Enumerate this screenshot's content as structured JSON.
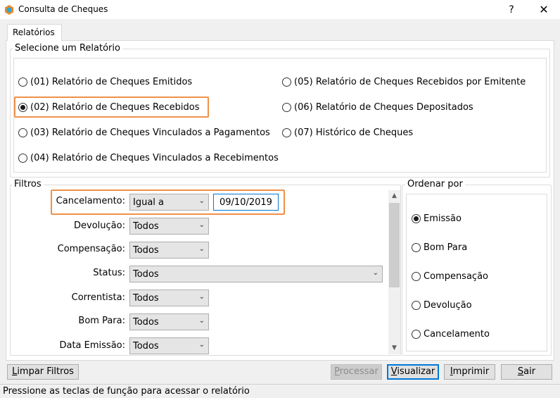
{
  "window": {
    "title": "Consulta de Cheques",
    "help": "?",
    "close": "✕",
    "accent_color": "#0078d7",
    "highlight_color": "#f0914a"
  },
  "tabs": [
    {
      "label": "Relatórios",
      "active": true
    }
  ],
  "report_group": {
    "legend": "Selecione um Relatório",
    "options": [
      {
        "label": "(01) Relatório de Cheques Emitidos",
        "selected": false
      },
      {
        "label": "(02) Relatório de Cheques Recebidos",
        "selected": true
      },
      {
        "label": "(03) Relatório de Cheques Vinculados a Pagamentos",
        "selected": false
      },
      {
        "label": "(04) Relatório de Cheques Vinculados a Recebimentos",
        "selected": false
      },
      {
        "label": "(05) Relatório de Cheques Recebidos por Emitente",
        "selected": false
      },
      {
        "label": "(06) Relatório de Cheques Depositados",
        "selected": false
      },
      {
        "label": "(07) Histórico de Cheques",
        "selected": false
      }
    ]
  },
  "filters": {
    "legend": "Filtros",
    "fields": [
      {
        "label": "Cancelamento:",
        "value": "Igual a",
        "date": "09/10/2019"
      },
      {
        "label": "Devolução:",
        "value": "Todos"
      },
      {
        "label": "Compensação:",
        "value": "Todos"
      },
      {
        "label": "Status:",
        "value": "Todos"
      },
      {
        "label": "Correntista:",
        "value": "Todos"
      },
      {
        "label": "Bom Para:",
        "value": "Todos"
      },
      {
        "label": "Data Emissão:",
        "value": "Todos"
      }
    ]
  },
  "order": {
    "legend": "Ordenar por",
    "options": [
      {
        "label": "Emissão",
        "selected": true
      },
      {
        "label": "Bom Para",
        "selected": false
      },
      {
        "label": "Compensação",
        "selected": false
      },
      {
        "label": "Devolução",
        "selected": false
      },
      {
        "label": "Cancelamento",
        "selected": false
      }
    ]
  },
  "buttons": {
    "limpar": {
      "accel": "L",
      "rest": "impar Filtros"
    },
    "processar": {
      "accel": "P",
      "rest": "rocessar"
    },
    "visualizar": {
      "accel": "V",
      "rest": "isualizar"
    },
    "imprimir": {
      "accel": "I",
      "rest": "mprimir"
    },
    "sair": {
      "accel": "S",
      "rest": "air"
    }
  },
  "status": "Pressione as teclas de função para acessar o relatório"
}
